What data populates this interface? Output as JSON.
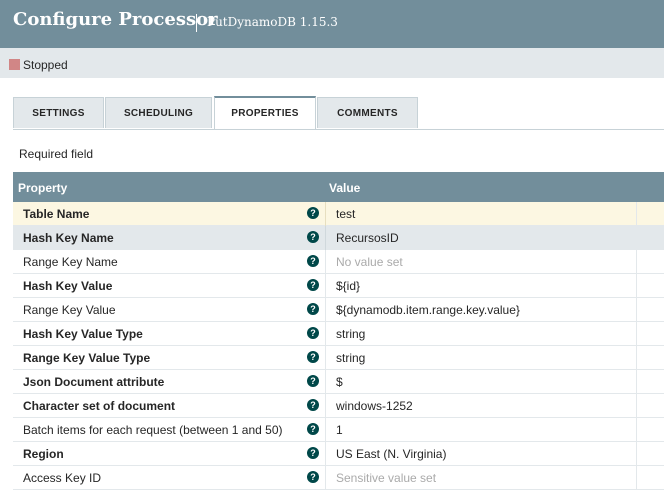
{
  "header": {
    "title": "Configure Processor",
    "subtitle": "PutDynamoDB 1.15.3"
  },
  "status": {
    "text": "Stopped",
    "color": "#d18686"
  },
  "tabs": [
    {
      "label": "SETTINGS",
      "active": false
    },
    {
      "label": "SCHEDULING",
      "active": false
    },
    {
      "label": "PROPERTIES",
      "active": true
    },
    {
      "label": "COMMENTS",
      "active": false
    }
  ],
  "required_field_label": "Required field",
  "grid": {
    "columns": {
      "property": "Property",
      "value": "Value"
    },
    "rows": [
      {
        "property": "Table Name",
        "value": "test",
        "required": true,
        "muted": false
      },
      {
        "property": "Hash Key Name",
        "value": "RecursosID",
        "required": true,
        "muted": false
      },
      {
        "property": "Range Key Name",
        "value": "No value set",
        "required": false,
        "muted": true
      },
      {
        "property": "Hash Key Value",
        "value": "${id}",
        "required": true,
        "muted": false
      },
      {
        "property": "Range Key Value",
        "value": "${dynamodb.item.range.key.value}",
        "required": false,
        "muted": false
      },
      {
        "property": "Hash Key Value Type",
        "value": "string",
        "required": true,
        "muted": false
      },
      {
        "property": "Range Key Value Type",
        "value": "string",
        "required": true,
        "muted": false
      },
      {
        "property": "Json Document attribute",
        "value": "$",
        "required": true,
        "muted": false
      },
      {
        "property": "Character set of document",
        "value": "windows-1252",
        "required": true,
        "muted": false
      },
      {
        "property": "Batch items for each request (between 1 and 50)",
        "value": "1",
        "required": false,
        "muted": false
      },
      {
        "property": "Region",
        "value": "US East (N. Virginia)",
        "required": true,
        "muted": false
      },
      {
        "property": "Access Key ID",
        "value": "Sensitive value set",
        "required": false,
        "muted": true
      }
    ]
  },
  "icons": {
    "help": "question-circle-icon",
    "status": "stop-square-icon"
  },
  "colors": {
    "header": "#728e9b",
    "help_icon": "#004849"
  }
}
